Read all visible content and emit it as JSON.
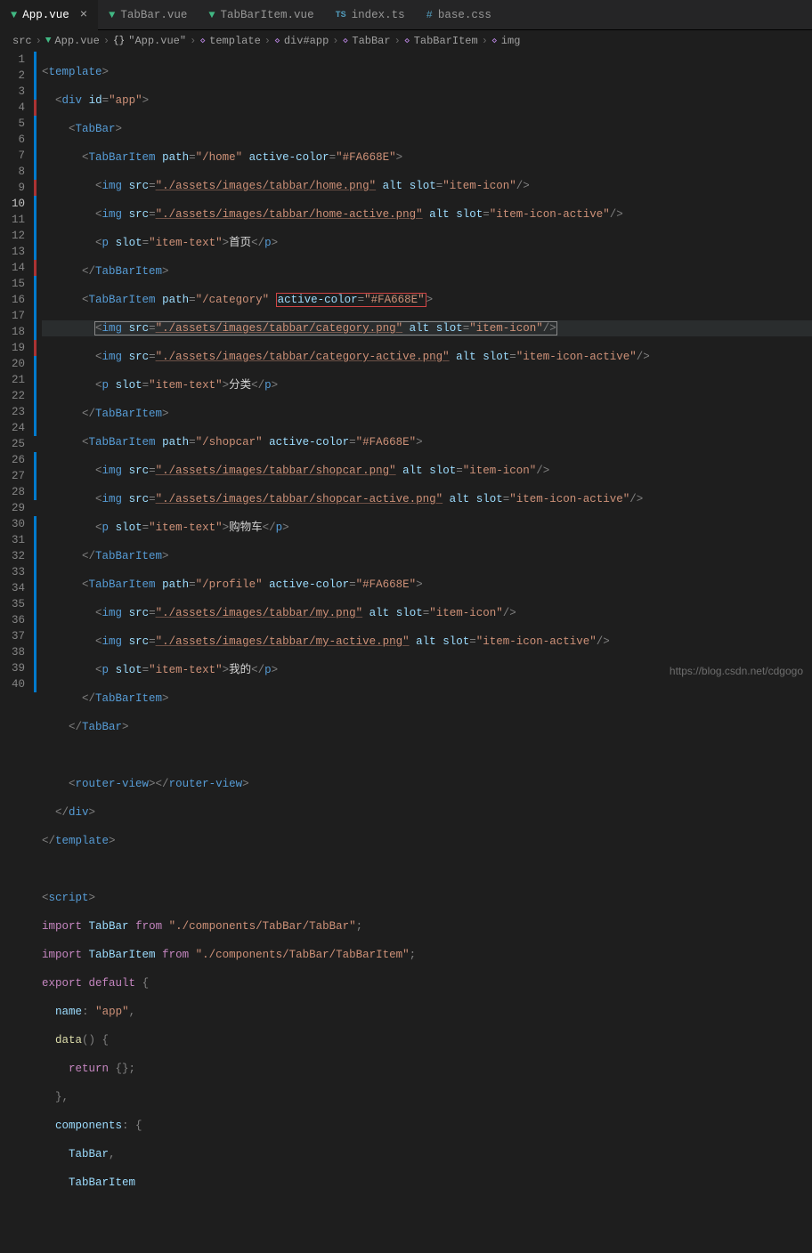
{
  "tabs": [
    {
      "label": "App.vue",
      "icon": "vue",
      "active": true,
      "close": true
    },
    {
      "label": "TabBar.vue",
      "icon": "vue"
    },
    {
      "label": "TabBarItem.vue",
      "icon": "vue"
    },
    {
      "label": "index.ts",
      "icon": "ts"
    },
    {
      "label": "base.css",
      "icon": "hash"
    }
  ],
  "breadcrumbs": [
    {
      "label": "src",
      "icon": ""
    },
    {
      "label": "App.vue",
      "icon": "vue"
    },
    {
      "label": "\"App.vue\"",
      "icon": "braces"
    },
    {
      "label": "template",
      "icon": "code"
    },
    {
      "label": "div#app",
      "icon": "code"
    },
    {
      "label": "TabBar",
      "icon": "code"
    },
    {
      "label": "TabBarItem",
      "icon": "code"
    },
    {
      "label": "img",
      "icon": "code"
    }
  ],
  "code": {
    "line_numbers": [
      "1",
      "2",
      "3",
      "4",
      "5",
      "6",
      "7",
      "8",
      "9",
      "10",
      "11",
      "12",
      "13",
      "14",
      "15",
      "16",
      "17",
      "18",
      "19",
      "20",
      "21",
      "22",
      "23",
      "24",
      "25",
      "26",
      "27",
      "28",
      "29",
      "30",
      "31",
      "32",
      "33",
      "34",
      "35",
      "36",
      "37",
      "38",
      "39",
      "40"
    ],
    "active_line": 10,
    "lines": {
      "template_open": "template",
      "div_tag": "div",
      "div_attr_id": "id",
      "div_id_val": "\"app\"",
      "tabbar": "TabBar",
      "tabbaritem": "TabBarItem",
      "attr_path": "path",
      "attr_active_color": "active-color",
      "val_home": "\"/home\"",
      "val_fa668e": "\"#FA668E\"",
      "val_category": "\"/category\"",
      "val_shopcar": "\"/shopcar\"",
      "val_profile": "\"/profile\"",
      "img": "img",
      "attr_src": "src",
      "attr_alt": "alt",
      "attr_slot": "slot",
      "val_item_icon": "\"item-icon\"",
      "val_item_icon_active": "\"item-icon-active\"",
      "val_item_text": "\"item-text\"",
      "p": "p",
      "src_home": "\"./assets/images/tabbar/home.png\"",
      "src_home_active": "\"./assets/images/tabbar/home-active.png\"",
      "src_category": "\"./assets/images/tabbar/category.png\"",
      "src_category_active": "\"./assets/images/tabbar/category-active.png\"",
      "src_shopcar": "\"./assets/images/tabbar/shopcar.png\"",
      "src_shopcar_active": "\"./assets/images/tabbar/shopcar-active.png\"",
      "src_my": "\"./assets/images/tabbar/my.png\"",
      "src_my_active": "\"./assets/images/tabbar/my-active.png\"",
      "txt_home": "首页",
      "txt_category": "分类",
      "txt_shopcar": "购物车",
      "txt_my": "我的",
      "router_view": "router-view",
      "script": "script",
      "kw_import": "import",
      "kw_from": "from",
      "kw_export": "export",
      "kw_default": "default",
      "kw_return": "return",
      "id_tabbar": "TabBar",
      "id_tabbaritem": "TabBarItem",
      "path_tabbar": "\"./components/TabBar/TabBar\"",
      "path_tabbaritem": "\"./components/TabBar/TabBarItem\"",
      "prop_name": "name",
      "val_app": "\"app\"",
      "fn_data": "data",
      "prop_components": "components"
    }
  },
  "watermark": "https://blog.csdn.net/cdgogo"
}
